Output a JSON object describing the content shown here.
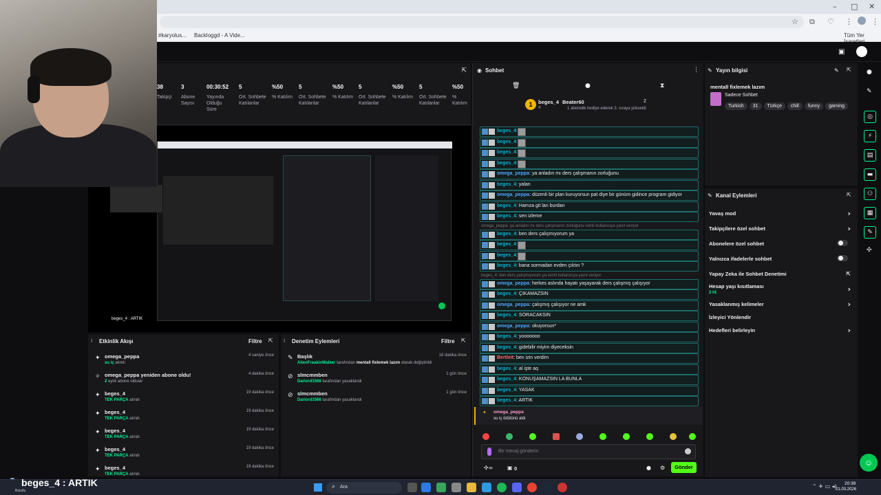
{
  "browser": {
    "bookmarks": [
      "#karyolus...",
      "Backloggd - A Vide..."
    ],
    "all_bookmarks": "Tüm Yer İşaretleri"
  },
  "stats": [
    {
      "value": "38",
      "label": "Takipçi"
    },
    {
      "value": "3",
      "label": "Abone Sayısı"
    },
    {
      "value": "00:30:52",
      "label": "Yayında Olduğu Süre"
    },
    {
      "value": "5",
      "label": "Ort. Sohbete Katılanlar"
    },
    {
      "value": "%50",
      "label": "% Katılım"
    },
    {
      "value": "5",
      "label": "Ort. Sohbete Katılanlar"
    },
    {
      "value": "%50",
      "label": "% Katılım"
    },
    {
      "value": "5",
      "label": "Ort. Sohbete Katılanlar"
    },
    {
      "value": "%50",
      "label": "% Katılım"
    },
    {
      "value": "5",
      "label": "Ort. Sohbete Katılanlar"
    },
    {
      "value": "%50",
      "label": "% Katılım"
    }
  ],
  "activity": {
    "title": "Etkinlik Akışı",
    "filter": "Filtre",
    "items": [
      {
        "user": "omega_peppa",
        "sub_a": "su iç",
        "sub_b": " alındı",
        "time": "4 saniye önce"
      },
      {
        "user": "omega_peppa yeniden abone oldu!",
        "sub_a": "2",
        "sub_b": " aylık abone oldular",
        "time": "4 dakika önce"
      },
      {
        "user": "beges_4",
        "sub_a": "TEK PARÇA",
        "sub_b": " alındı",
        "time": "19 dakika önce"
      },
      {
        "user": "beges_4",
        "sub_a": "TEK PARÇA",
        "sub_b": " alındı",
        "time": "19 dakika önce"
      },
      {
        "user": "beges_4",
        "sub_a": "TEK PARÇA",
        "sub_b": " alındı",
        "time": "19 dakika önce"
      },
      {
        "user": "beges_4",
        "sub_a": "TEK PARÇA",
        "sub_b": " alındı",
        "time": "19 dakika önce"
      },
      {
        "user": "beges_4",
        "sub_a": "TEK PARÇA",
        "sub_b": " alındı",
        "time": "19 dakika önce"
      }
    ]
  },
  "moderation": {
    "title": "Denetim Eylemleri",
    "filter": "Filtre",
    "items": [
      {
        "user": "Başlık",
        "sub_a": "AlienFreakinWalker",
        "sub_b": " tarafından ",
        "sub_c": "mentall fixlemek lazım",
        "sub_d": " olarak değiştirildi",
        "time": "18 dakika önce"
      },
      {
        "user": "slmcmmben",
        "sub_a": "Dariord1566",
        "sub_b": " tarafından yasaklandı",
        "time": "1 gün önce"
      },
      {
        "user": "slmcmmben",
        "sub_a": "Dariord1566",
        "sub_b": " tarafından yasaklandı",
        "time": "1 gün önce"
      }
    ]
  },
  "chat": {
    "title": "Sohbet",
    "top_user": "beges_4",
    "top_count": "4",
    "gift_user": "Beater60",
    "gift_count": "2",
    "gift_text": "1 abonelik hediye ederek 3. sıraya yükseldi",
    "messages": [
      {
        "name": "beges_4",
        "text": "",
        "thumb": true
      },
      {
        "name": "beges_4",
        "text": "",
        "thumb": true
      },
      {
        "name": "beges_4",
        "text": "",
        "thumb": true
      },
      {
        "name": "beges_4",
        "text": "",
        "thumb": true
      },
      {
        "name": "omega_peppa",
        "text": "ya anladın mı ders çalışmanın zorluğunu"
      },
      {
        "name": "beges_4",
        "text": "yalan"
      },
      {
        "name": "omega_peppa",
        "text": "düzenli bir plan kuruyorsun pat diye bir günüm gidince program gidiyor"
      },
      {
        "name": "beges_4",
        "text": "Hamza git lan burdan"
      },
      {
        "name": "beges_4",
        "text": "sen izleme"
      },
      {
        "reply": "omega_peppa: ya anladın mı ders çalışmanın zorluğunu isimli kullanıcıya yanıt veriyor"
      },
      {
        "name": "beges_4",
        "text": "ben ders çalışmıyorum ya"
      },
      {
        "name": "beges_4",
        "text": "",
        "thumb": true
      },
      {
        "name": "beges_4",
        "text": "",
        "thumb": true
      },
      {
        "name": "beges_4",
        "text": "bana sormadan evden çıktın ?"
      },
      {
        "reply": "beges_4: ben ders çalışmıyorum ya isimli kullanıcıya yanıt veriyor"
      },
      {
        "name": "omega_peppa",
        "text": "herkes aslında hayatı yaşayarak ders çalışmış çalışıyor"
      },
      {
        "name": "beges_4",
        "text": "ÇIKAMAZSIN"
      },
      {
        "name": "omega_peppa",
        "text": "çalışmış çalışıyor ne amk"
      },
      {
        "name": "beges_4",
        "text": "SORACAKSIN"
      },
      {
        "name": "omega_peppa",
        "text": "okuyorsun*"
      },
      {
        "name": "beges_4",
        "text": "yooooooo"
      },
      {
        "name": "beges_4",
        "text": "gidebilir miyim diyeceksin"
      },
      {
        "name": "Bertleit",
        "text": "ben izin verdim"
      },
      {
        "name": "beges_4",
        "text": "al işte aq"
      },
      {
        "name": "beges_4",
        "text": "KONUŞAMAZSIN LA BUNLA"
      },
      {
        "name": "beges_4",
        "text": "YASAK"
      },
      {
        "name": "beges_4",
        "text": "ARTIK"
      }
    ],
    "reward_user": "omega_peppa",
    "reward_text": "su iç ödülünü aldı",
    "input_placeholder": "Bir mesaj gönderin",
    "points": "0",
    "send": "Gönder"
  },
  "stream_info": {
    "title": "Yayın bilgisi",
    "stream_title": "mentall fixlemek lazım",
    "category": "Sadece Sohbet",
    "tags": [
      "Turkish",
      "31",
      "Türkçe",
      "chill",
      "funny",
      "gaming"
    ]
  },
  "channel_actions": {
    "title": "Kanal Eylemleri",
    "items": [
      {
        "label": "Yavaş mod",
        "kind": "chev"
      },
      {
        "label": "Takipçilere özel sohbet",
        "kind": "chev"
      },
      {
        "label": "Abonelere özel sohbet",
        "kind": "toggle"
      },
      {
        "label": "Yalnızca ifadelerle sohbet",
        "kind": "toggle"
      },
      {
        "label": "Yapay Zeka ile Sohbet Denetimi",
        "kind": "ext"
      },
      {
        "label": "Hesap yaşı kısıtlaması",
        "sub": "2 hf.",
        "kind": "chev"
      },
      {
        "label": "Yasaklanmış kelimeler",
        "kind": "chev"
      },
      {
        "label": "İzleyici Yönlendir",
        "kind": "none"
      },
      {
        "label": "Hedefleri belirleyin",
        "kind": "chev"
      }
    ]
  },
  "overlay": {
    "caption": "beges_4 : ARTIK",
    "weather": "Bulutlu"
  },
  "taskbar": {
    "search": "Ara",
    "time": "20:38",
    "date": "21.03.2026"
  }
}
